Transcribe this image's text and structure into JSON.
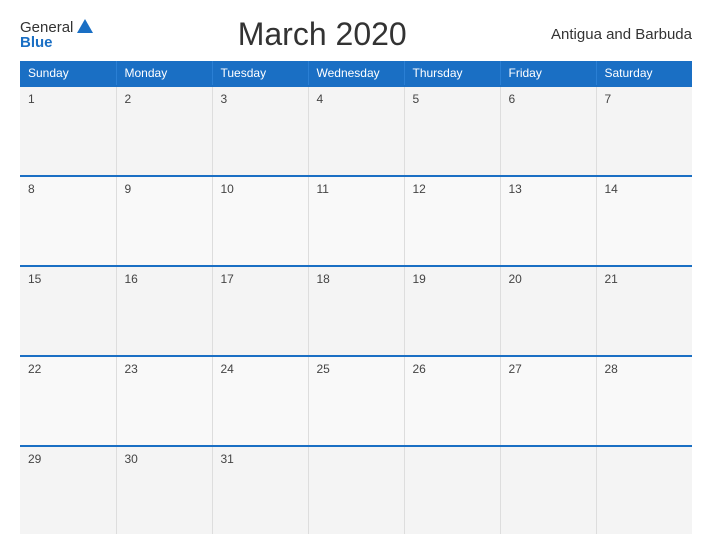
{
  "header": {
    "logo_general": "General",
    "logo_blue": "Blue",
    "title": "March 2020",
    "country": "Antigua and Barbuda"
  },
  "calendar": {
    "days": [
      "Sunday",
      "Monday",
      "Tuesday",
      "Wednesday",
      "Thursday",
      "Friday",
      "Saturday"
    ],
    "weeks": [
      [
        1,
        2,
        3,
        4,
        5,
        6,
        7
      ],
      [
        8,
        9,
        10,
        11,
        12,
        13,
        14
      ],
      [
        15,
        16,
        17,
        18,
        19,
        20,
        21
      ],
      [
        22,
        23,
        24,
        25,
        26,
        27,
        28
      ],
      [
        29,
        30,
        31,
        null,
        null,
        null,
        null
      ]
    ]
  }
}
